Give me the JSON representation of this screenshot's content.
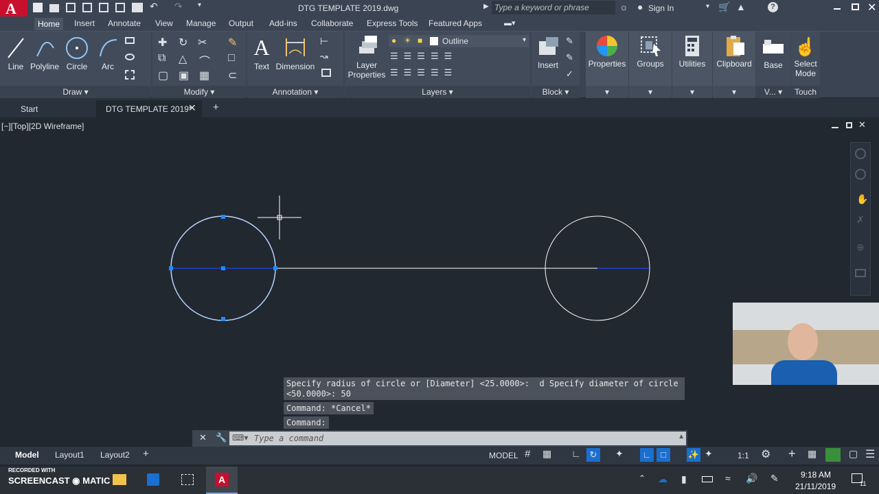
{
  "titlebar": {
    "file_title": "DTG TEMPLATE 2019.dwg",
    "search_placeholder": "Type a keyword or phrase",
    "sign_in": "Sign In"
  },
  "ribbon_tabs": [
    "Home",
    "Insert",
    "Annotate",
    "View",
    "Manage",
    "Output",
    "Add-ins",
    "Collaborate",
    "Express Tools",
    "Featured Apps"
  ],
  "ribbon": {
    "draw": {
      "title": "Draw",
      "tools": [
        "Line",
        "Polyline",
        "Circle",
        "Arc"
      ]
    },
    "modify": {
      "title": "Modify"
    },
    "annotation": {
      "title": "Annotation",
      "tools": [
        "Text",
        "Dimension"
      ]
    },
    "layers": {
      "title": "Layers",
      "layer_properties": "Layer\nProperties",
      "layer_name": "Outline"
    },
    "block": {
      "title": "Block",
      "insert": "Insert"
    },
    "properties": "Properties",
    "groups": "Groups",
    "utilities": "Utilities",
    "clipboard": "Clipboard",
    "base": "Base",
    "view_short": "V...",
    "select_mode": "Select\nMode",
    "touch": "Touch"
  },
  "file_tabs": {
    "start": "Start",
    "active": "DTG TEMPLATE 2019*"
  },
  "viewport": {
    "label": "[−][Top][2D Wireframe]"
  },
  "command": {
    "history": [
      "Specify radius of circle or [Diameter] <25.0000>: _d Specify diameter of circle",
      "<50.0000>: 50",
      "Command: *Cancel*",
      "Command:"
    ],
    "input_placeholder": "Type a command"
  },
  "layout_tabs": [
    "Model",
    "Layout1",
    "Layout2"
  ],
  "status": {
    "model": "MODEL",
    "scale": "1:1"
  },
  "taskbar": {
    "time": "9:18 AM",
    "date": "21/11/2019",
    "notif_count": "11",
    "watermark_top": "RECORDED WITH",
    "watermark_brand": "SCREENCAST ◉ MATIC"
  },
  "colors": {
    "accent": "#1e8bff",
    "panel": "#414b5a",
    "canvas": "#212830",
    "autocad_red": "#c8102e"
  }
}
